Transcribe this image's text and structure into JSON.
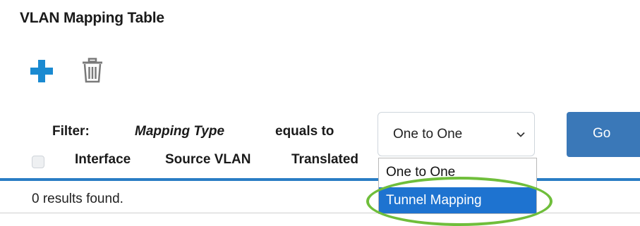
{
  "page": {
    "title": "VLAN Mapping Table"
  },
  "toolbar": {
    "add_icon": "plus-icon",
    "delete_icon": "trash-icon",
    "add_color": "#1a8ad1",
    "delete_color": "#7a7a7a"
  },
  "filter": {
    "label": "Filter:",
    "field": "Mapping Type",
    "operator": "equals to",
    "selected_value": "One to One",
    "options": [
      "One to One",
      "Tunnel Mapping"
    ],
    "highlighted_option": "Tunnel Mapping",
    "go_label": "Go"
  },
  "table": {
    "columns": [
      "Interface",
      "Source VLAN",
      "Translated"
    ],
    "results_text": "0 results found."
  },
  "colors": {
    "accent": "#2a7dc4",
    "go_button": "#3a78b8",
    "option_highlight": "#1e73d0",
    "annotation_ring": "#6fbe3b"
  }
}
